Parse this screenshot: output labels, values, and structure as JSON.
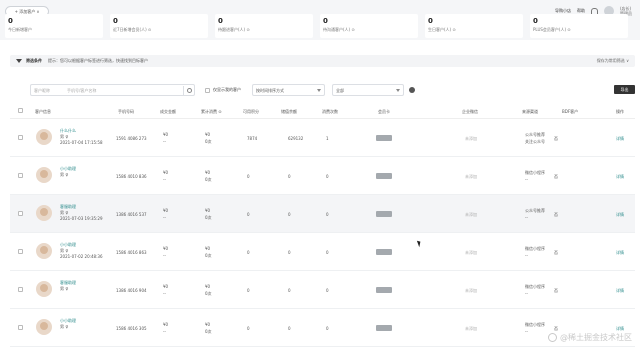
{
  "header": {
    "add_button": "+ 添加客户 ∨",
    "links": [
      "导购小店",
      "帮助"
    ],
    "user_name": "(店长)",
    "user_sub": "管理员"
  },
  "stats": [
    {
      "num": "0",
      "label": "今日新增客户"
    },
    {
      "num": "0",
      "label": "近7日新增会员(人) ⊙"
    },
    {
      "num": "0",
      "label": "待跟进客户(人) ⊙"
    },
    {
      "num": "0",
      "label": "待沟通客户(人) ⊙"
    },
    {
      "num": "0",
      "label": "生日客户(人) ⊙"
    },
    {
      "num": "0",
      "label": "PLUS会员客户(人) ⊙"
    }
  ],
  "tipbar": {
    "title": "筛选条件",
    "text": "提示：您可以根据客户标签进行筛选，快速找到目标客户",
    "right": "保存为常用筛选 ∨"
  },
  "toolbar": {
    "search_placeholder": "客户昵称",
    "search_placeholder2": "手机号/客户名称",
    "checkbox_label": "仅显示我的客户",
    "select1": "按时间排序方式",
    "select2": "全部",
    "export": "导出"
  },
  "table": {
    "headers": [
      "客户信息",
      "手机号码",
      "成交金额",
      "累计消费 ⊙",
      "可用积分",
      "储值余额",
      "消费次数",
      "会员卡",
      "企业微信",
      "来源渠道",
      "BDF客户",
      "操作"
    ],
    "rows": [
      {
        "name": "什么什么",
        "gender": "男 ♀",
        "regtime": "2021-07-04 17:15:58",
        "phone": "1591 4086 273",
        "deal": "¥0",
        "deal_sub": "--",
        "paid": "¥0",
        "paid_sub": "0次",
        "points": "7874",
        "balance": "629132",
        "count": "1",
        "corp": "未添加",
        "source": "公众号推荐",
        "source_sub": "关注公众号",
        "biz": "否",
        "op": "详情"
      },
      {
        "name": "小小助理",
        "gender": "男 ♀",
        "regtime": "",
        "phone": "1586 4010 836",
        "deal": "¥0",
        "deal_sub": "--",
        "paid": "¥0",
        "paid_sub": "0次",
        "points": "0",
        "balance": "0",
        "count": "0",
        "corp": "未添加",
        "source": "微信小程序",
        "source_sub": "--",
        "biz": "否",
        "op": "详情"
      },
      {
        "name": "客服助理",
        "gender": "男 ♀",
        "regtime": "2021-07-03 19:35:29",
        "phone": "1386 4016 537",
        "deal": "¥0",
        "deal_sub": "--",
        "paid": "¥0",
        "paid_sub": "0次",
        "points": "0",
        "balance": "0",
        "count": "0",
        "corp": "未添加",
        "source": "公众号推荐",
        "source_sub": "--",
        "biz": "否",
        "op": "详情"
      },
      {
        "name": "小小助理",
        "gender": "男 ♀",
        "regtime": "2021-07-02 20:48:36",
        "phone": "1586 4016 863",
        "deal": "¥0",
        "deal_sub": "--",
        "paid": "¥0",
        "paid_sub": "0次",
        "points": "0",
        "balance": "0",
        "count": "0",
        "corp": "未添加",
        "source": "微信小程序",
        "source_sub": "--",
        "biz": "否",
        "op": "详情"
      },
      {
        "name": "客服助理",
        "gender": "男 ♀",
        "regtime": "",
        "phone": "1386 4016 904",
        "deal": "¥0",
        "deal_sub": "--",
        "paid": "¥0",
        "paid_sub": "0次",
        "points": "0",
        "balance": "0",
        "count": "0",
        "corp": "未添加",
        "source": "微信小程序",
        "source_sub": "--",
        "biz": "否",
        "op": "详情"
      },
      {
        "name": "小小助理",
        "gender": "男 ♀",
        "regtime": "",
        "phone": "1586 4016 305",
        "deal": "¥0",
        "deal_sub": "--",
        "paid": "¥0",
        "paid_sub": "0次",
        "points": "0",
        "balance": "0",
        "count": "0",
        "corp": "未添加",
        "source": "微信小程序",
        "source_sub": "--",
        "biz": "否",
        "op": "详情"
      }
    ]
  },
  "watermark": "@稀土掘金技术社区"
}
